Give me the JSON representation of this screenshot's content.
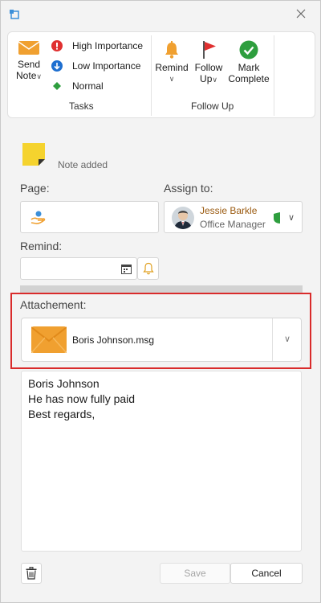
{
  "ribbon": {
    "send_note": {
      "line1": "Send",
      "line2": "Note"
    },
    "importance": [
      {
        "label": "High Importance",
        "icon": "exclamation-icon"
      },
      {
        "label": "Low Importance",
        "icon": "down-arrow-icon"
      },
      {
        "label": "Normal",
        "icon": "diamond-icon"
      }
    ],
    "tasks_group_label": "Tasks",
    "remind": {
      "line1": "Remind"
    },
    "follow_up": {
      "line1": "Follow",
      "line2": "Up"
    },
    "mark_complete": {
      "line1": "Mark",
      "line2": "Complete"
    },
    "follow_up_group_label": "Follow Up"
  },
  "note": {
    "status": "Note added"
  },
  "page_field": {
    "label": "Page:"
  },
  "assign_field": {
    "label": "Assign to:",
    "name": "Jessie Barkle",
    "role": "Office Manager"
  },
  "remind_field": {
    "label": "Remind:",
    "value": ""
  },
  "attachment": {
    "label": "Attachement:",
    "file_name": "Boris Johnson.msg"
  },
  "body_text": {
    "line1": "Boris Johnson",
    "line2": "He has now fully paid",
    "line3": "Best regards,"
  },
  "footer": {
    "save_label": "Save",
    "cancel_label": "Cancel"
  },
  "colors": {
    "accent_orange": "#f0a030",
    "flag_red": "#e03030",
    "check_green": "#2e9e3e",
    "highlight_red": "#d92b2b"
  }
}
